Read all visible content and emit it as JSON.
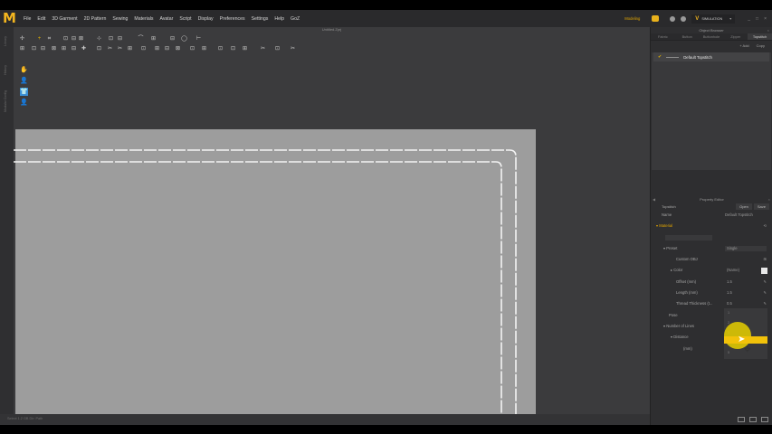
{
  "app": {
    "logo_letter": "M",
    "menu": [
      "File",
      "Edit",
      "3D Garment",
      "2D Pattern",
      "Sewing",
      "Materials",
      "Avatar",
      "Script",
      "Display",
      "Preferences",
      "Settings",
      "Help",
      "GoZ"
    ],
    "mode_label": "Modeling",
    "simulation_label": "SIMULATION",
    "window_buttons": [
      "_",
      "□",
      "×"
    ],
    "file_title": "Untitled.Zprj",
    "status_text": "Select 1.2 GB   Dir: Path",
    "accent_color": "#f2b51f"
  },
  "toolbar_row1": [
    "✢",
    "+",
    "⌗",
    "⊡",
    "⊟",
    "⊠",
    "⊹",
    "⊡",
    "⊟",
    "⌒",
    "⊞",
    "⊟",
    "◯",
    "⊢"
  ],
  "toolbar_row2": [
    "⊞",
    "⊡",
    "⊟",
    "⊠",
    "⊞",
    "⊟",
    "✚",
    "⊡",
    "✂",
    "✂",
    "⊞",
    "⊡",
    "⊞",
    "⊟",
    "⊠",
    "⊡",
    "⊞",
    "⊡",
    "⊡",
    "⊞",
    "✂",
    "⊡",
    "✂"
  ],
  "object_browser": {
    "title": "Object Browser",
    "tabs": [
      "Fabric",
      "Button",
      "Buttonhole",
      "Zipper",
      "Topstitch"
    ],
    "active_tab": "Topstitch",
    "add_label": "+ Add",
    "copy_label": "Copy",
    "items": [
      {
        "name": "Default Topstitch",
        "checked": true
      }
    ]
  },
  "property_editor": {
    "title": "Property Editor",
    "type_label": "Topstitch",
    "open_label": "Open",
    "save_label": "Save",
    "name_label": "Name",
    "name_value": "Default Topstitch",
    "material_label": "Material",
    "preset_label": "Preset",
    "preset_value": "Single",
    "custom_obj_label": "Custom OBJ",
    "color_label": "Color",
    "color_value": "(Name)",
    "offset_label": "Offset (mm)",
    "offset_value": "1.5",
    "length_label": "Length (mm)",
    "length_value": "1.5",
    "thread_label": "Thread Thickness (t...",
    "thread_value": "0.5",
    "pose_label": "Pose",
    "number_label": "Number of Lines",
    "distance_label": "Distance",
    "mm_label": "(mm)",
    "dropdown_options": [
      "1",
      "2",
      "3",
      "4",
      "5"
    ]
  },
  "side_tools": [
    "✋",
    "👤",
    "👕",
    "👤"
  ]
}
